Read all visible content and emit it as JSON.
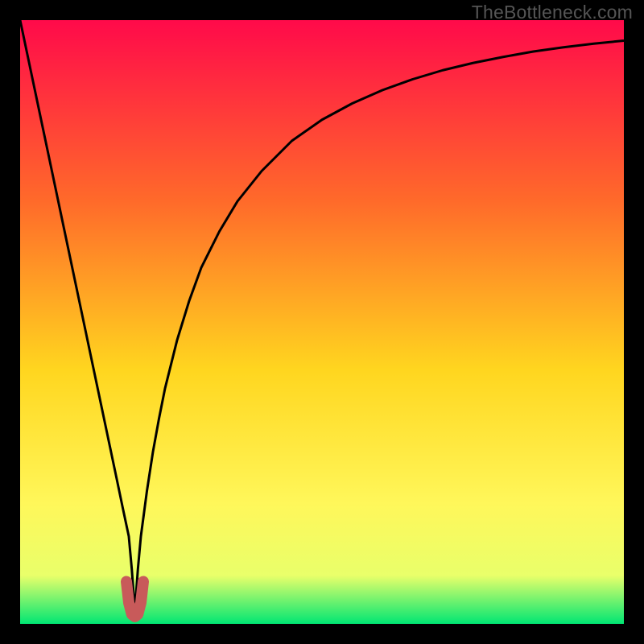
{
  "watermark": "TheBottleneck.com",
  "colors": {
    "bg": "#000000",
    "grad_top": "#ff0a4a",
    "grad_mid1": "#ff6a2a",
    "grad_mid2": "#ffd61f",
    "grad_mid3": "#fff75a",
    "grad_mid4": "#e9ff6a",
    "grad_bottom": "#00e673",
    "curve": "#000000",
    "marker": "#c85a5a"
  },
  "chart_data": {
    "type": "line",
    "title": "",
    "xlabel": "",
    "ylabel": "",
    "xlim": [
      0,
      100
    ],
    "ylim": [
      0,
      100
    ],
    "grid": false,
    "legend": null,
    "notch_x": 19,
    "series": [
      {
        "name": "bottleneck-curve",
        "x": [
          0,
          2,
          4,
          6,
          8,
          10,
          12,
          14,
          16,
          17,
          18,
          18.5,
          19,
          19.5,
          20,
          21,
          22,
          23,
          24,
          26,
          28,
          30,
          33,
          36,
          40,
          45,
          50,
          55,
          60,
          65,
          70,
          75,
          80,
          85,
          90,
          95,
          100
        ],
        "y": [
          100,
          90.5,
          81,
          71.5,
          62,
          52.5,
          43,
          33.5,
          24,
          19.2,
          14.5,
          9,
          2,
          9,
          14.5,
          22,
          28.5,
          34,
          39,
          47,
          53.5,
          59,
          65,
          70,
          75,
          80,
          83.5,
          86.2,
          88.4,
          90.2,
          91.7,
          92.9,
          93.9,
          94.8,
          95.5,
          96.1,
          96.6
        ]
      },
      {
        "name": "notch-marker",
        "x": [
          17.6,
          18.0,
          18.5,
          19.0,
          19.5,
          20.0,
          20.4
        ],
        "y": [
          7.0,
          3.5,
          1.6,
          1.2,
          1.6,
          3.5,
          7.0
        ]
      }
    ]
  }
}
